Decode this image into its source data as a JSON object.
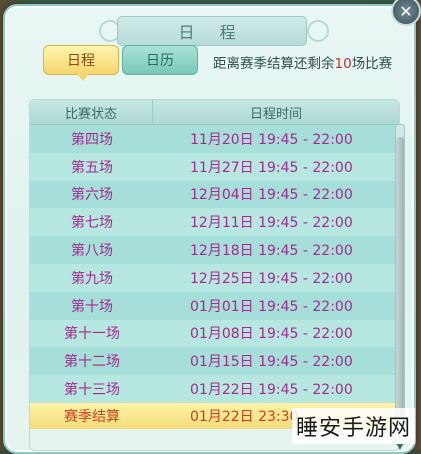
{
  "title": "日 程",
  "tabs": {
    "schedule": "日程",
    "calendar": "日历"
  },
  "info": {
    "prefix": "距离赛季结算还剩余",
    "count": "10",
    "suffix": "场比赛"
  },
  "table": {
    "headers": [
      "比赛状态",
      "日程时间"
    ],
    "rows": [
      {
        "status": "第四场",
        "time": "11月20日  19:45 - 22:00"
      },
      {
        "status": "第五场",
        "time": "11月27日  19:45 - 22:00"
      },
      {
        "status": "第六场",
        "time": "12月04日  19:45 - 22:00"
      },
      {
        "status": "第七场",
        "time": "12月11日  19:45 - 22:00"
      },
      {
        "status": "第八场",
        "time": "12月18日  19:45 - 22:00"
      },
      {
        "status": "第九场",
        "time": "12月25日  19:45 - 22:00"
      },
      {
        "status": "第十场",
        "time": "01月01日  19:45 - 22:00"
      },
      {
        "status": "第十一场",
        "time": "01月08日  19:45 - 22:00"
      },
      {
        "status": "第十二场",
        "time": "01月15日  19:45 - 22:00"
      },
      {
        "status": "第十三场",
        "time": "01月22日  19:45 - 22:00"
      }
    ],
    "settle": {
      "status": "赛季结算",
      "time": "01月22日  23:30"
    }
  },
  "close_glyph": "✕",
  "watermark": "睡安手游网",
  "colors": {
    "status_text": "#a52a8c",
    "highlight_num": "#d22c2c",
    "settle_text": "#d1401c"
  }
}
